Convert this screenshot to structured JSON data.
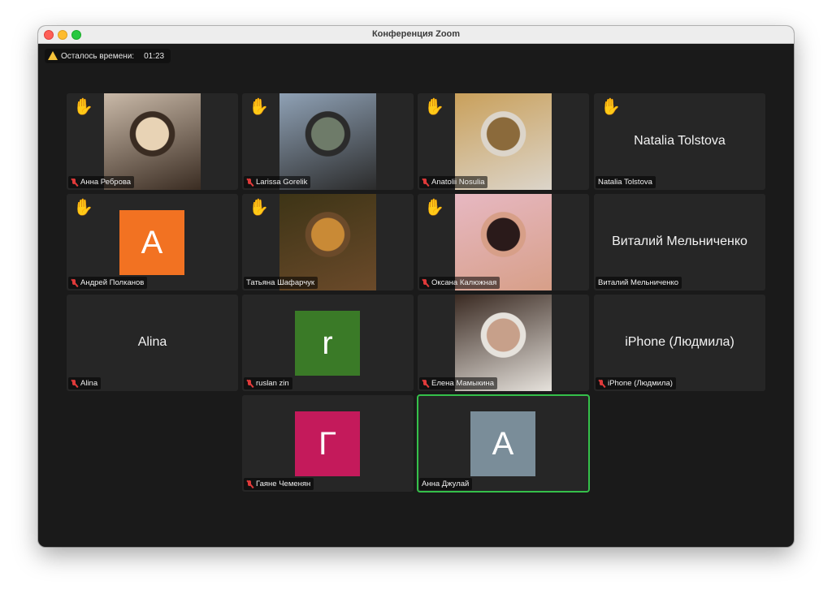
{
  "window": {
    "title": "Конференция Zoom"
  },
  "timer": {
    "label": "Осталось времени:",
    "value": "01:23"
  },
  "participants": [
    {
      "name": "Анна Реброва",
      "kind": "photo",
      "hand": true,
      "muted": true,
      "photo_colors": [
        "#c9b9a8",
        "#e8d3b5",
        "#3a2c22"
      ]
    },
    {
      "name": "Larissa Gorelik",
      "kind": "photo",
      "hand": true,
      "muted": true,
      "photo_colors": [
        "#8fa1b5",
        "#6e7b69",
        "#2b2b2b"
      ]
    },
    {
      "name": "Anatolii Nosulia",
      "kind": "photo",
      "hand": true,
      "muted": true,
      "photo_colors": [
        "#c9a05b",
        "#8b6a3b",
        "#dcd5ca"
      ]
    },
    {
      "name": "Natalia Tolstova",
      "kind": "name",
      "hand": true,
      "muted": false,
      "display_name": "Natalia Tolstova"
    },
    {
      "name": "Андрей Полканов",
      "kind": "avatar",
      "hand": true,
      "muted": true,
      "letter": "A",
      "color": "#f27222"
    },
    {
      "name": "Татьяна Шафарчук",
      "kind": "photo",
      "hand": true,
      "muted": false,
      "photo_colors": [
        "#3d3416",
        "#c98a36",
        "#6b4a2a"
      ]
    },
    {
      "name": "Оксана Калюжная",
      "kind": "photo",
      "hand": true,
      "muted": true,
      "photo_colors": [
        "#e7b8c2",
        "#2a1a1a",
        "#d79f88"
      ]
    },
    {
      "name": "Виталий Мельниченко",
      "kind": "name",
      "hand": false,
      "muted": false,
      "display_name": "Виталий Мельниченко"
    },
    {
      "name": "Alina",
      "kind": "name",
      "hand": false,
      "muted": true,
      "display_name": "Alina"
    },
    {
      "name": "ruslan zin",
      "kind": "avatar",
      "hand": false,
      "muted": true,
      "letter": "r",
      "color": "#3a7a27"
    },
    {
      "name": "Елена Мамыкина",
      "kind": "photo",
      "hand": false,
      "muted": true,
      "photo_colors": [
        "#3a2a22",
        "#c7a08a",
        "#e6e2dc"
      ]
    },
    {
      "name": "iPhone (Людмила)",
      "kind": "name",
      "hand": false,
      "muted": true,
      "display_name": "iPhone (Людмила)"
    },
    {
      "name": "Гаяне Чеменян",
      "kind": "avatar",
      "hand": false,
      "muted": true,
      "letter": "Г",
      "color": "#c41a5b"
    },
    {
      "name": "Анна Джулай",
      "kind": "avatar",
      "hand": false,
      "muted": false,
      "letter": "A",
      "color": "#7a8d99",
      "active_speaker": true
    }
  ]
}
